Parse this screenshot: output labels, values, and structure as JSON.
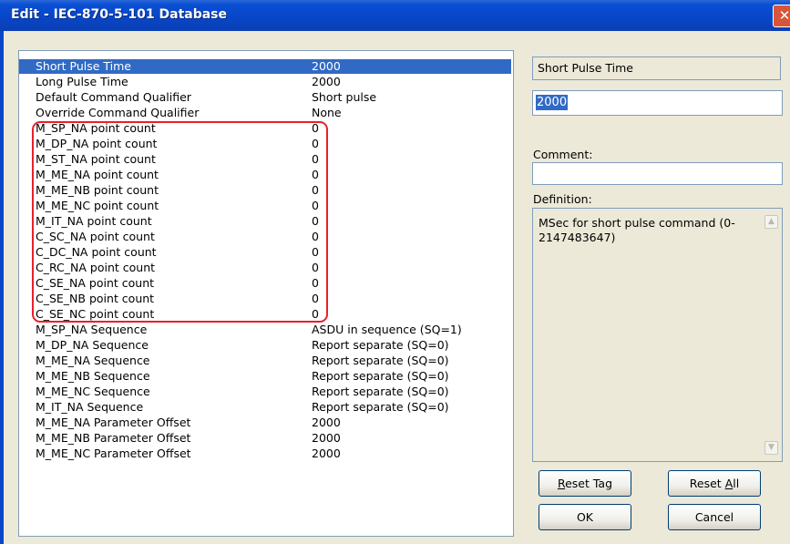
{
  "window": {
    "title": "Edit - IEC-870-5-101 Database",
    "close_glyph": "✕"
  },
  "list": {
    "rows": [
      {
        "name": "Short Pulse Time",
        "value": "2000",
        "selected": true
      },
      {
        "name": "Long Pulse Time",
        "value": "2000"
      },
      {
        "name": "Default Command Qualifier",
        "value": "Short pulse"
      },
      {
        "name": "Override Command Qualifier",
        "value": "None"
      },
      {
        "name": "M_SP_NA point count",
        "value": "0"
      },
      {
        "name": "M_DP_NA point count",
        "value": "0"
      },
      {
        "name": "M_ST_NA point count",
        "value": "0"
      },
      {
        "name": "M_ME_NA point count",
        "value": "0"
      },
      {
        "name": "M_ME_NB point count",
        "value": "0"
      },
      {
        "name": "M_ME_NC point count",
        "value": "0"
      },
      {
        "name": "M_IT_NA point count",
        "value": "0"
      },
      {
        "name": "C_SC_NA point count",
        "value": "0"
      },
      {
        "name": "C_DC_NA point count",
        "value": "0"
      },
      {
        "name": "C_RC_NA point count",
        "value": "0"
      },
      {
        "name": "C_SE_NA point count",
        "value": "0"
      },
      {
        "name": "C_SE_NB point count",
        "value": "0"
      },
      {
        "name": "C_SE_NC point count",
        "value": "0"
      },
      {
        "name": "M_SP_NA Sequence",
        "value": "ASDU in sequence (SQ=1)"
      },
      {
        "name": "M_DP_NA Sequence",
        "value": "Report separate (SQ=0)"
      },
      {
        "name": "M_ME_NA Sequence",
        "value": "Report separate (SQ=0)"
      },
      {
        "name": "M_ME_NB Sequence",
        "value": "Report separate (SQ=0)"
      },
      {
        "name": "M_ME_NC Sequence",
        "value": "Report separate (SQ=0)"
      },
      {
        "name": "M_IT_NA Sequence",
        "value": "Report separate (SQ=0)"
      },
      {
        "name": "M_ME_NA Parameter Offset",
        "value": "2000"
      },
      {
        "name": "M_ME_NB Parameter Offset",
        "value": "2000"
      },
      {
        "name": "M_ME_NC Parameter Offset",
        "value": "2000"
      }
    ],
    "highlight_color": "#e8202a",
    "selection_color": "#316ac5"
  },
  "editor": {
    "selected_name": "Short Pulse Time",
    "value": "2000",
    "comment_label": "Comment:",
    "comment_value": "",
    "definition_label": "Definition:",
    "definition_text": "MSec for short pulse command (0-2147483647)"
  },
  "buttons": {
    "reset_tag": "Reset Tag",
    "reset_all": "Reset All",
    "ok": "OK",
    "cancel": "Cancel"
  }
}
